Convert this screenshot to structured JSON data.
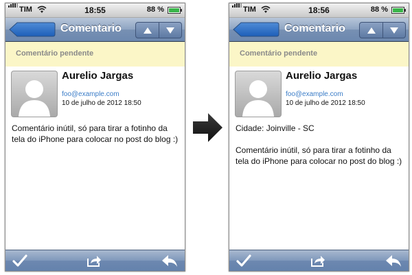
{
  "left_screen": {
    "status": {
      "carrier": "TIM",
      "time": "18:55",
      "battery": "88 %",
      "battery_level": 0.88
    },
    "nav": {
      "title": "Comentario",
      "back_label": ""
    },
    "pending": "Comentário pendente",
    "author": {
      "name": "Aurelio Jargas",
      "email": "foo@example.com",
      "date": "10 de julho de 2012 18:50"
    },
    "comment": "Comentário inútil, só para tirar a fotinho da tela do iPhone para colocar no post do blog :)"
  },
  "right_screen": {
    "status": {
      "carrier": "TIM",
      "time": "18:56",
      "battery": "88 %",
      "battery_level": 0.88
    },
    "nav": {
      "title": "Comentario",
      "back_label": ""
    },
    "pending": "Comentário pendente",
    "author": {
      "name": "Aurelio Jargas",
      "email": "foo@example.com",
      "date": "10 de julho de 2012 18:50"
    },
    "city": "Cidade: Joinville - SC",
    "comment": "Comentário inútil, só para tirar a fotinho da tela do iPhone para colocar no post do blog :)"
  },
  "toolbar_icons": [
    "check-icon",
    "share-icon",
    "reply-icon"
  ],
  "nav_icons": [
    "arrow-up-icon",
    "arrow-down-icon"
  ],
  "colors": {
    "navbar": "#7790b3",
    "pending_bg": "#fbf6c7",
    "email_link": "#3a7cc7",
    "battery_fill": "#39b54a"
  }
}
